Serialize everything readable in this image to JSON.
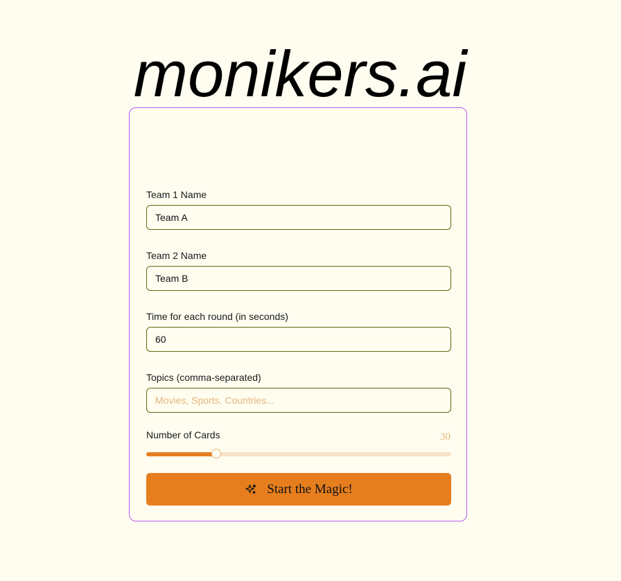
{
  "app": {
    "title": "monikers.ai"
  },
  "form": {
    "team1": {
      "label": "Team 1 Name",
      "value": "Team A"
    },
    "team2": {
      "label": "Team 2 Name",
      "value": "Team B"
    },
    "round_time": {
      "label": "Time for each round (in seconds)",
      "value": "60"
    },
    "topics": {
      "label": "Topics (comma-separated)",
      "value": "",
      "placeholder": "Movies, Sports, Countries..."
    },
    "num_cards": {
      "label": "Number of Cards",
      "value": "30",
      "slider_fraction": 0.23
    },
    "start_button": {
      "label": "Start the Magic!",
      "icon": "sparkles-icon"
    }
  },
  "colors": {
    "background": "#fefdf0",
    "card_border": "#b85cf0",
    "input_border": "#6b6410",
    "accent": "#e67e1e",
    "muted_accent": "#e8b47a",
    "slider_track": "#f8e2c8"
  }
}
